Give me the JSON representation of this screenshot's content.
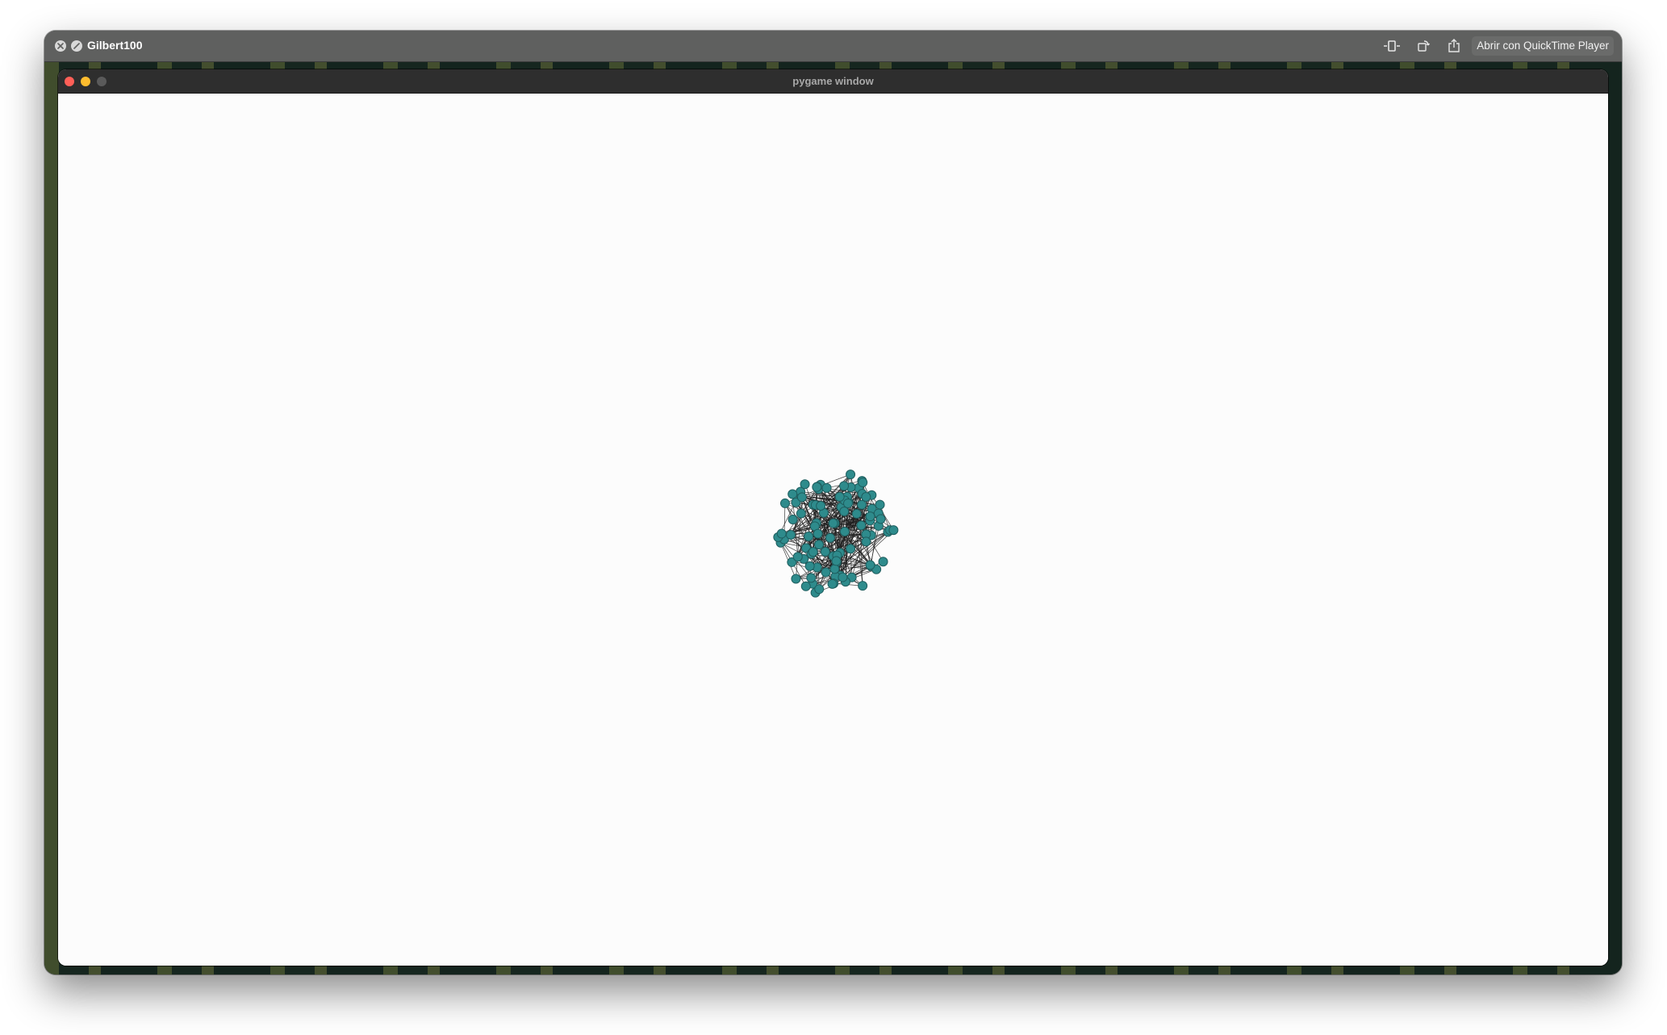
{
  "quicklook": {
    "title": "Gilbert100",
    "open_with_label": "Abrir con QuickTime Player",
    "icons": [
      "close-icon",
      "fullscreen-icon",
      "trim-icon",
      "rotate-icon",
      "share-icon"
    ]
  },
  "pygame_window": {
    "title": "pygame window",
    "traffic_light_colors": {
      "close": "#ff5f57",
      "minimize": "#febc2e",
      "zoom": "#5a5a5a"
    }
  },
  "graph": {
    "node_color": "#2e8b8c",
    "node_stroke": "#1f5e5f",
    "edge_color": "#1e1e1e",
    "background": "#fcfcfc",
    "node_count": 100
  }
}
